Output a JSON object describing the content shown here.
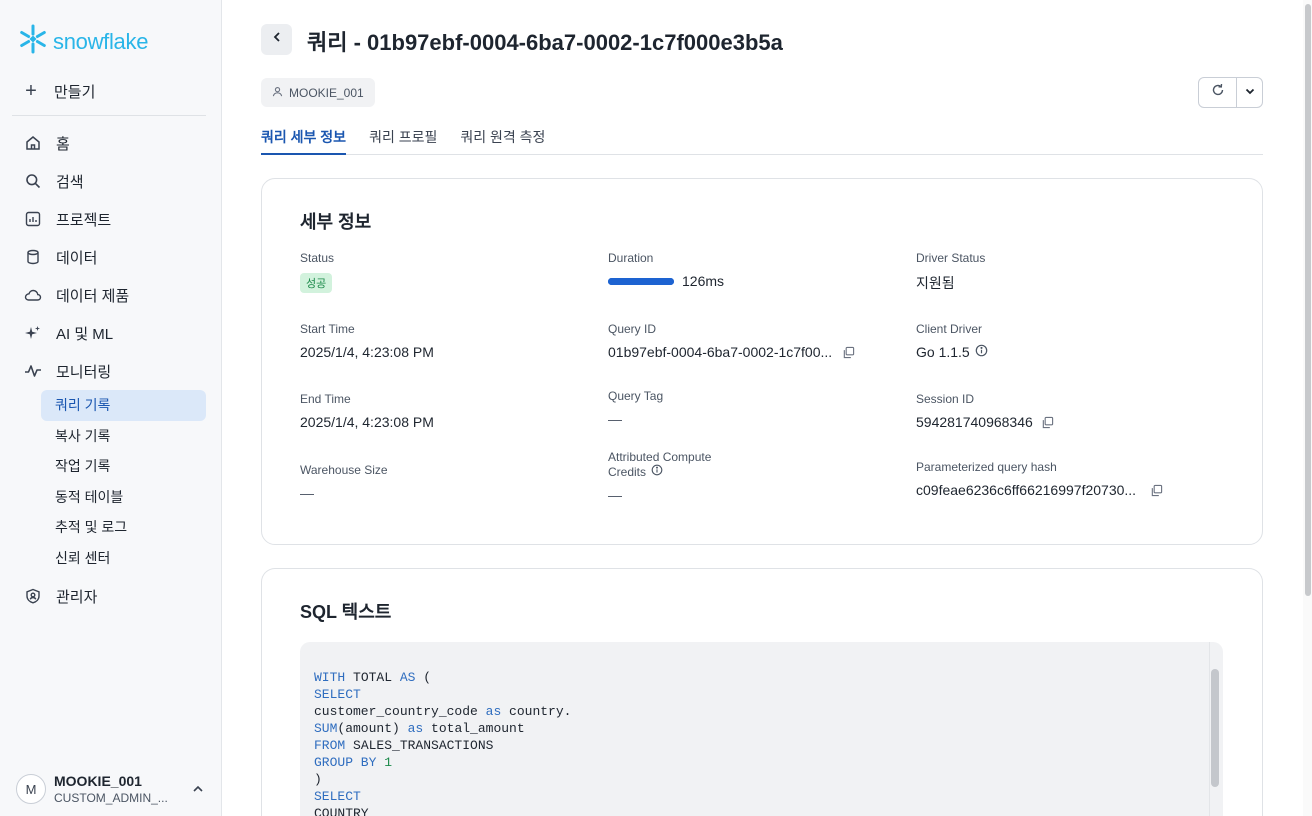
{
  "app": {
    "logo_text": "snowflake",
    "brand_color": "#29b5e8",
    "accent_color": "#1a56b0"
  },
  "sidebar": {
    "create_label": "만들기",
    "items": [
      {
        "label": "홈",
        "icon": "home-icon"
      },
      {
        "label": "검색",
        "icon": "search-icon"
      },
      {
        "label": "프로젝트",
        "icon": "project-icon"
      },
      {
        "label": "데이터",
        "icon": "database-icon"
      },
      {
        "label": "데이터 제품",
        "icon": "cloud-icon"
      },
      {
        "label": "AI 및 ML",
        "icon": "sparkle-icon"
      },
      {
        "label": "모니터링",
        "icon": "activity-icon"
      }
    ],
    "monitoring_sub": [
      {
        "label": "쿼리 기록",
        "active": true
      },
      {
        "label": "복사 기록",
        "active": false
      },
      {
        "label": "작업 기록",
        "active": false
      },
      {
        "label": "동적 테이블",
        "active": false
      },
      {
        "label": "추적 및 로그",
        "active": false
      },
      {
        "label": "신뢰 센터",
        "active": false
      }
    ],
    "admin_label": "관리자",
    "user": {
      "initial": "M",
      "name": "MOOKIE_001",
      "role": "CUSTOM_ADMIN_..."
    }
  },
  "header": {
    "title": "쿼리 - 01b97ebf-0004-6ba7-0002-1c7f000e3b5a",
    "user_chip": "MOOKIE_001"
  },
  "tabs": [
    {
      "label": "쿼리 세부 정보",
      "active": true
    },
    {
      "label": "쿼리 프로필",
      "active": false
    },
    {
      "label": "쿼리 원격 측정",
      "active": false
    }
  ],
  "details": {
    "title": "세부 정보",
    "status_label": "Status",
    "status_value": "성공",
    "duration_label": "Duration",
    "duration_value": "126ms",
    "duration_fill": 1.0,
    "driver_status_label": "Driver Status",
    "driver_status_value": "지원됨",
    "start_time_label": "Start Time",
    "start_time_value": "2025/1/4, 4:23:08 PM",
    "query_id_label": "Query ID",
    "query_id_value": "01b97ebf-0004-6ba7-0002-1c7f00...",
    "client_driver_label": "Client Driver",
    "client_driver_value": "Go 1.1.5",
    "end_time_label": "End Time",
    "end_time_value": "2025/1/4, 4:23:08 PM",
    "query_tag_label": "Query Tag",
    "query_tag_value": "—",
    "session_id_label": "Session ID",
    "session_id_value": "594281740968346",
    "warehouse_size_label": "Warehouse Size",
    "warehouse_size_value": "—",
    "credits_label_1": "Attributed Compute",
    "credits_label_2": "Credits",
    "credits_value": "—",
    "pq_hash_label": "Parameterized query hash",
    "pq_hash_value": "c09feae6236c6ff66216997f20730..."
  },
  "sql": {
    "title": "SQL 텍스트",
    "lines": [
      [
        {
          "t": "WITH",
          "k": "kw"
        },
        {
          "t": " TOTAL ",
          "k": ""
        },
        {
          "t": "AS",
          "k": "kw"
        },
        {
          "t": " (",
          "k": ""
        }
      ],
      [
        {
          "t": "SELECT",
          "k": "kw"
        }
      ],
      [
        {
          "t": "customer_country_code ",
          "k": ""
        },
        {
          "t": "as",
          "k": "kw"
        },
        {
          "t": " country.",
          "k": ""
        }
      ],
      [
        {
          "t": "SUM",
          "k": "kw"
        },
        {
          "t": "(amount) ",
          "k": ""
        },
        {
          "t": "as",
          "k": "kw"
        },
        {
          "t": " total_amount",
          "k": ""
        }
      ],
      [
        {
          "t": "FROM",
          "k": "kw"
        },
        {
          "t": " SALES_TRANSACTIONS",
          "k": ""
        }
      ],
      [
        {
          "t": "GROUP BY",
          "k": "kw"
        },
        {
          "t": " ",
          "k": ""
        },
        {
          "t": "1",
          "k": "num"
        }
      ],
      [
        {
          "t": ")",
          "k": ""
        }
      ],
      [
        {
          "t": "SELECT",
          "k": "kw"
        }
      ],
      [
        {
          "t": "COUNTRY",
          "k": ""
        }
      ]
    ]
  }
}
